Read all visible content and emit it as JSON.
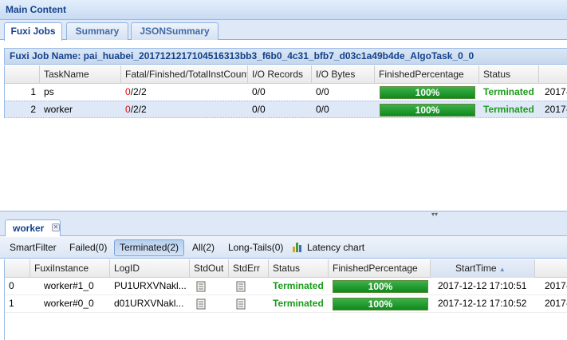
{
  "panel": {
    "title": "Main Content"
  },
  "tabs": [
    {
      "label": "Fuxi Jobs",
      "active": true
    },
    {
      "label": "Summary",
      "active": false
    },
    {
      "label": "JSONSummary",
      "active": false
    }
  ],
  "job": {
    "header": "Fuxi Job Name: pai_huabei_2017121217104516313bb3_f6b0_4c31_bfb7_d03c1a49b4de_AlgoTask_0_0",
    "columns": [
      "TaskName",
      "Fatal/Finished/TotalInstCount",
      "I/O Records",
      "I/O Bytes",
      "FinishedPercentage",
      "Status",
      ""
    ],
    "rows": [
      {
        "index": "1",
        "name": "ps",
        "fatal": "0",
        "rest": "/2/2",
        "records": "0/0",
        "bytes": "0/0",
        "percent": "100%",
        "progress": 100,
        "status": "Terminated",
        "time": "2017-",
        "selected": false
      },
      {
        "index": "2",
        "name": "worker",
        "fatal": "0",
        "rest": "/2/2",
        "records": "0/0",
        "bytes": "0/0",
        "percent": "100%",
        "progress": 100,
        "status": "Terminated",
        "time": "2017-",
        "selected": true
      }
    ]
  },
  "detail": {
    "tab_label": "worker",
    "toolbar": {
      "smartfilter": "SmartFilter",
      "failed": "Failed(0)",
      "terminated": "Terminated(2)",
      "all": "All(2)",
      "longtails": "Long-Tails(0)",
      "latency": "Latency chart"
    },
    "columns": [
      "",
      "FuxiInstance",
      "LogID",
      "StdOut",
      "StdErr",
      "Status",
      "FinishedPercentage",
      "StartTime",
      ""
    ],
    "rows": [
      {
        "index": "0",
        "instance": "worker#1_0",
        "logid": "PU1URXVNakl...",
        "status": "Terminated",
        "percent": "100%",
        "progress": 100,
        "start": "2017-12-12 17:10:51",
        "end": "2017-"
      },
      {
        "index": "1",
        "instance": "worker#0_0",
        "logid": "d01URXVNakl...",
        "status": "Terminated",
        "percent": "100%",
        "progress": 100,
        "start": "2017-12-12 17:10:52",
        "end": "2017-"
      }
    ]
  },
  "icons": {
    "doc": "document-icon",
    "chart": "bar-chart-icon",
    "close": "close-icon",
    "sort": "sort-ascending-icon"
  },
  "colors": {
    "accent": "#15428b",
    "terminated": "#1a9c1a",
    "progress": "#0d8a1c",
    "fatal": "#e00000"
  }
}
